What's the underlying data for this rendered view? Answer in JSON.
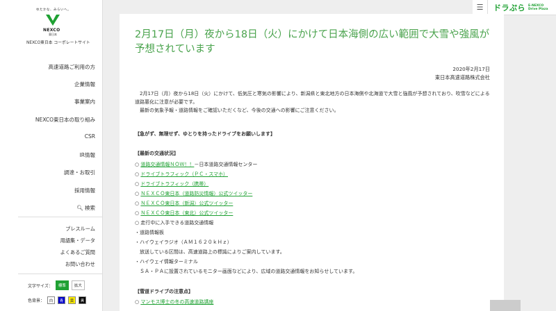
{
  "sidebar": {
    "tagline": "ゆたかな、みらいへ。",
    "logo_text": "NEXCO",
    "logo_sub": "東日本",
    "site_name": "NEXCO東日本 コーポレートサイト",
    "nav": [
      "高速道路ご利用の方",
      "企業情報",
      "事業案内",
      "NEXCO東日本の取り組み",
      "CSR",
      "IR情報",
      "調達・お取引",
      "採用情報"
    ],
    "search_label": "検索",
    "sub_links": [
      "プレスルーム",
      "用語集・データ",
      "よくあるご質問",
      "お問い合わせ"
    ],
    "font_size_label": "文字サイズ：",
    "font_size_options": [
      "標準",
      "拡大"
    ],
    "color_label": "色背景：",
    "color_options": [
      "白",
      "青",
      "黄",
      "黒"
    ]
  },
  "topbar": {
    "logo": "ドラぷら",
    "sub_logo_line1": "E-NEXCO",
    "sub_logo_line2": "Drive Plaza"
  },
  "article": {
    "title": "2月17日（月）夜から18日（火）にかけて日本海側の広い範囲で大雪や強風が予想されています",
    "date": "2020年2月17日",
    "company": "東日本高速道路株式会社",
    "para1": "　2月17日（月）夜から18日（火）にかけて、低気圧と寒気の影響により、新潟県と東北地方の日本海側や北海道で大雪と強風が予想されており、吹雪などによる道路悪化に注意が必要です。",
    "para2": "　最新の気象予報・道路情報をご確認いただくなど、今後の交通への影響にご注意ください。",
    "heading1": "【急がず、無理せず、ゆとりを持ったドライブをお願いします】",
    "heading2": "【最新の交通状況】",
    "links": [
      {
        "prefix": "○ ",
        "link": "道路交通情報ＮＯＷ！！",
        "suffix": "－日本道路交通情報センター"
      },
      {
        "prefix": "○ ",
        "link": "ドライブトラフィック（ＰＣ・スマホ）",
        "suffix": ""
      },
      {
        "prefix": "○ ",
        "link": "ドライブトラフィック（携帯）",
        "suffix": ""
      },
      {
        "prefix": "○ ",
        "link": "ＮＥＸＣＯ東日本（道路防災情報）公式ツイッター",
        "suffix": ""
      },
      {
        "prefix": "○ ",
        "link": "ＮＥＸＣＯ東日本（新潟）公式ツイッター",
        "suffix": ""
      },
      {
        "prefix": "○ ",
        "link": "ＮＥＸＣＯ東日本（東北）公式ツイッター",
        "suffix": ""
      }
    ],
    "item_drive": "○ 走行中に入手できる道路交通情報",
    "item_board": "・道路情報板",
    "item_radio": "・ハイウェイラジオ（ＡＭ１６２０ｋＨｚ）",
    "item_radio_desc": "　放送している区間は、高速道路上の標識によりご案内しています。",
    "item_terminal": "・ハイウェイ情報ターミナル",
    "item_terminal_desc": "　ＳＡ・ＰＡに設置されているモニター画面などにより、広域の道路交通情報をお知らせしています。",
    "heading3": "【雪道ドライブの注意点】",
    "last_link_prefix": "○ ",
    "last_link": "マンモス博士の冬の高速道路講座"
  }
}
